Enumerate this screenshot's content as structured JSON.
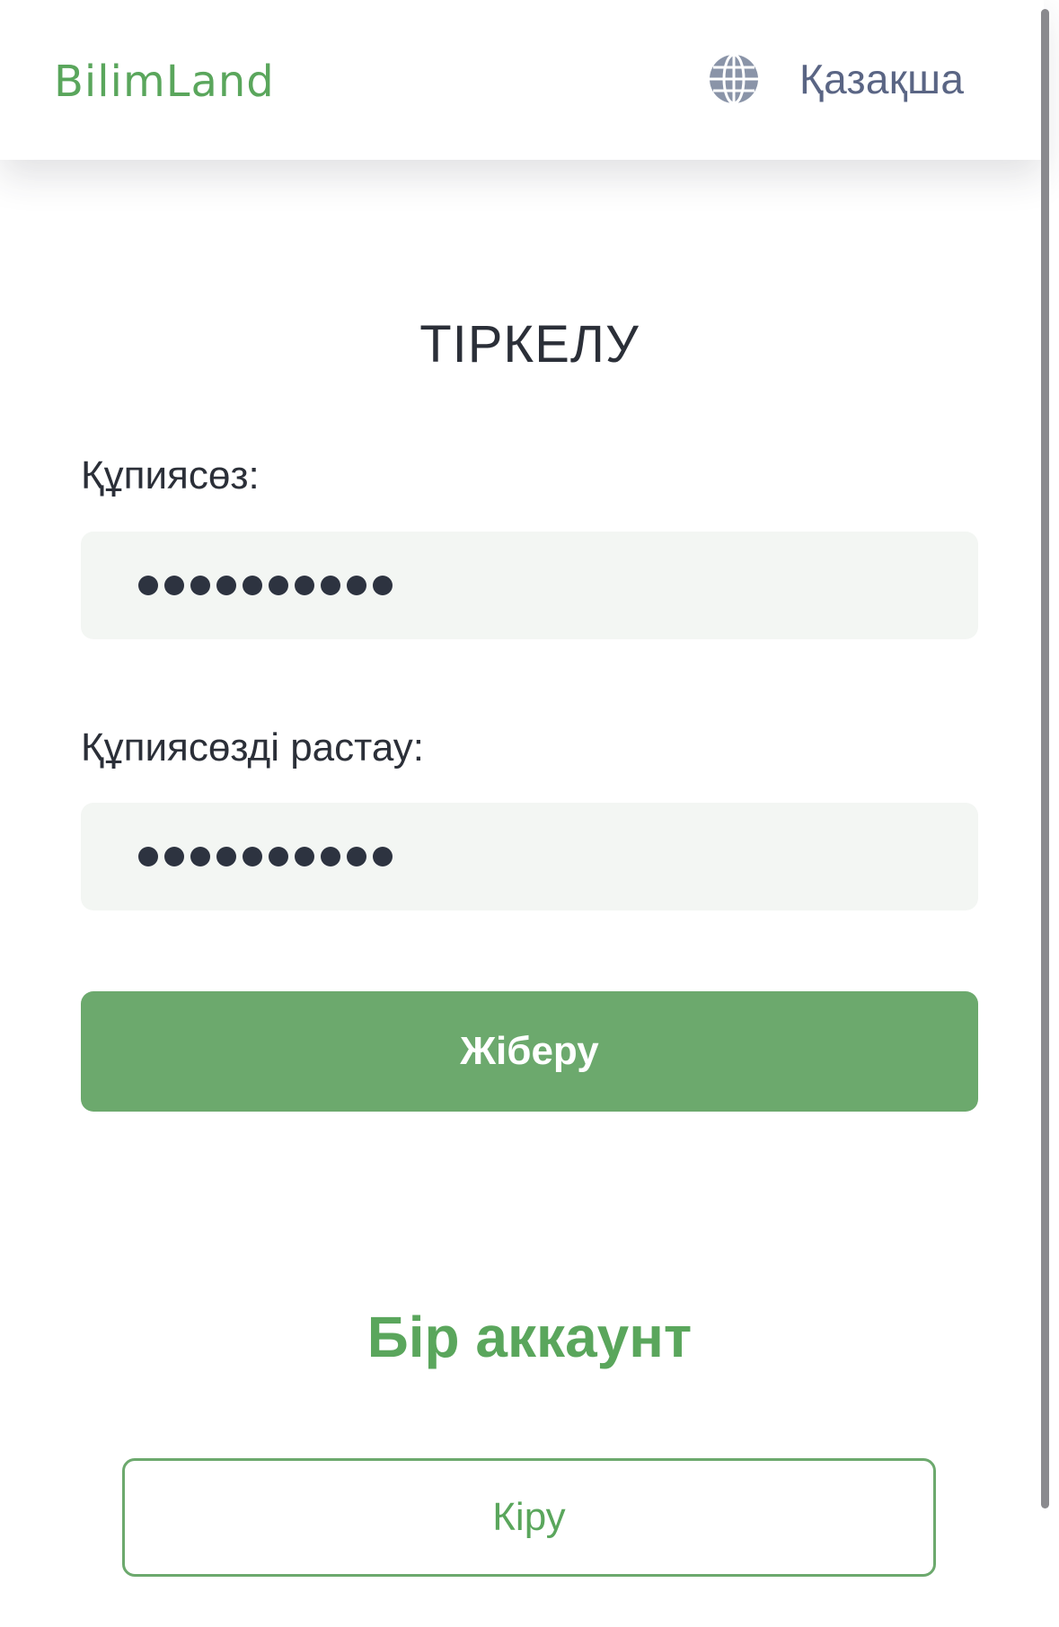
{
  "header": {
    "logo_text": "BilimLand",
    "language_label": "Қазақша",
    "language_icon": "globe-icon"
  },
  "form": {
    "title": "ТІРКЕЛУ",
    "password_label": "Құпиясөз:",
    "password_value_masked": "••••••••••",
    "password_length": 10,
    "confirm_label": "Құпиясөзді растау:",
    "confirm_value_masked": "••••••••••",
    "confirm_length": 10,
    "submit_label": "Жіберу"
  },
  "footer": {
    "heading": "Бір аккаунт",
    "login_label": "Кіру"
  },
  "colors": {
    "brand_green": "#5aa65c",
    "button_green": "#6ca96d",
    "input_bg": "#f3f6f3",
    "text_dark": "#2b2f38",
    "lang_text": "#5a6584"
  }
}
